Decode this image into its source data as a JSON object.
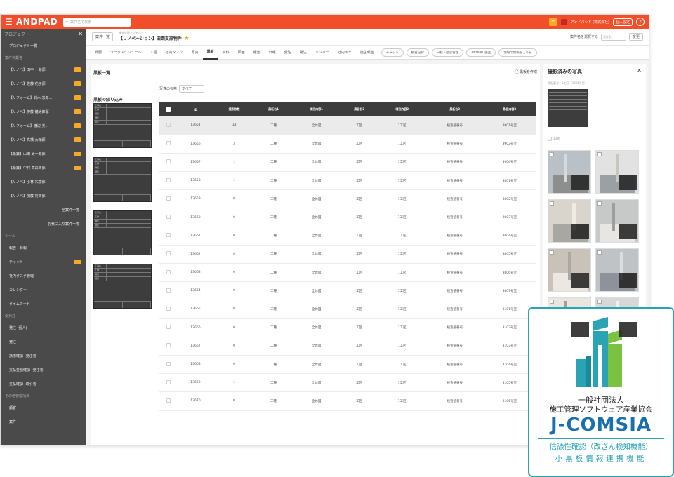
{
  "topbar": {
    "logo": "ANDPAD",
    "search_placeholder": "案件名で検索",
    "badge_count": "35",
    "company": "アンドパッド (株式会社)",
    "user_button": "個人設定",
    "help": "?"
  },
  "sidebar": {
    "header": "プロジェクト",
    "close": "✕",
    "items": [
      {
        "label": "プロジェクト一覧"
      },
      {
        "label": "案件作業者",
        "type": "section"
      },
      {
        "label": "【リノベ】田中 一郎邸",
        "badge": true
      },
      {
        "label": "【リノベ】佐藤 花子邸",
        "badge": true
      },
      {
        "label": "【リフォーム】鈴木 次郎...",
        "badge": true
      },
      {
        "label": "【リノベ】伊藤 健太郎邸",
        "badge": true
      },
      {
        "label": "【リフォーム】渡辺 美...",
        "badge": true
      },
      {
        "label": "【リノベ】高橋 大輔邸",
        "badge": true
      },
      {
        "label": "【新築】山田 太一郎邸",
        "badge": true
      },
      {
        "label": "【新築】中村 真由美邸",
        "badge": true
      },
      {
        "label": "【リノベ】小林 祐樹邸"
      },
      {
        "label": "【リノベ】加藤 裕美邸"
      },
      {
        "label": "全案件一覧",
        "type": "right"
      },
      {
        "label": "お気に入り案件一覧",
        "type": "right"
      },
      {
        "label": "ツール",
        "type": "section"
      },
      {
        "label": "報告・日報"
      },
      {
        "label": "チャット",
        "badge": true
      },
      {
        "label": "社内タスク管理"
      },
      {
        "label": "カレンダー"
      },
      {
        "label": "タイムカード"
      },
      {
        "label": "受発注",
        "type": "section"
      },
      {
        "label": "発注 (個人)"
      },
      {
        "label": "発注"
      },
      {
        "label": "請求確認 (発注者)"
      },
      {
        "label": "支払金額確認 (発注者)"
      },
      {
        "label": "支払確認 (取引者)"
      },
      {
        "label": "その他管理項目",
        "type": "section"
      },
      {
        "label": "顧客"
      },
      {
        "label": "案件"
      }
    ]
  },
  "header": {
    "back": "案件一覧",
    "company": "株式会社アンドパッド",
    "project": "【リノベーション】田園支部物件",
    "star": "★",
    "right_label": "案件名を選択する",
    "right_input": "案件名",
    "right_button": "変更"
  },
  "tabs": [
    {
      "label": "概要"
    },
    {
      "label": "ワークスケジュール"
    },
    {
      "label": "工程"
    },
    {
      "label": "社内タスク"
    },
    {
      "label": "写真"
    },
    {
      "label": "黒板",
      "active": true
    },
    {
      "label": "資料"
    },
    {
      "label": "図面"
    },
    {
      "label": "報告"
    },
    {
      "label": "日報"
    },
    {
      "label": "受注"
    },
    {
      "label": "発注"
    },
    {
      "label": "メンバー"
    },
    {
      "label": "社内メモ"
    },
    {
      "label": "施主報告"
    }
  ],
  "tab_buttons": [
    "チャット",
    "検査記録",
    "日程・勤怠管理",
    "ANDPAD施主",
    "現場の情報をこちら"
  ],
  "main": {
    "title": "黒板一覧",
    "link": "黒板を作成",
    "filter_label": "写真の有無",
    "filter_value": "すべて",
    "narrow_title": "黒板の絞り込み",
    "board_rows": [
      "工事名",
      "工種",
      "種別",
      "細別",
      "測点"
    ]
  },
  "table": {
    "headers": [
      "",
      "ID",
      "撮影枚数",
      "黒板名1",
      "項目内容1",
      "黒板名2",
      "項目内容2",
      "黒板名3",
      "黒板内容3"
    ],
    "rows": [
      [
        "13654",
        "13",
        "工種",
        "全体図",
        "工区",
        "1工区",
        "検査値番号",
        "3901号室"
      ],
      [
        "13656",
        "3",
        "工種",
        "全体図",
        "工区",
        "1工区",
        "検査値番号",
        "3902号室"
      ],
      [
        "13657",
        "1",
        "工種",
        "全体図",
        "工区",
        "1工区",
        "検査値番号",
        "3904号室"
      ],
      [
        "13658",
        "1",
        "工種",
        "全体図",
        "工区",
        "1工区",
        "検査値番号",
        "3801号室"
      ],
      [
        "13659",
        "0",
        "工種",
        "全体図",
        "工区",
        "1工区",
        "検査値番号",
        "3802号室"
      ],
      [
        "13660",
        "0",
        "工種",
        "全体図",
        "工区",
        "1工区",
        "検査値番号",
        "3803号室"
      ],
      [
        "13661",
        "0",
        "工種",
        "全体図",
        "工区",
        "1工区",
        "検査値番号",
        "3804号室"
      ],
      [
        "13662",
        "0",
        "工種",
        "全体図",
        "工区",
        "1工区",
        "検査値番号",
        "3805号室"
      ],
      [
        "13663",
        "0",
        "工種",
        "全体図",
        "工区",
        "1工区",
        "検査値番号",
        "3806号室"
      ],
      [
        "13664",
        "0",
        "工種",
        "全体図",
        "工区",
        "1工区",
        "検査値番号",
        "3807号室"
      ],
      [
        "13665",
        "0",
        "工種",
        "全体図",
        "工区",
        "1工区",
        "検査値番号",
        "3101号室"
      ],
      [
        "13666",
        "0",
        "工種",
        "全体図",
        "工区",
        "1工区",
        "検査値番号",
        "3102号室"
      ],
      [
        "13667",
        "0",
        "工種",
        "全体図",
        "工区",
        "1工区",
        "検査値番号",
        "3103号室"
      ],
      [
        "13668",
        "0",
        "工種",
        "全体図",
        "工区",
        "1工区",
        "検査値番号",
        "3104号室"
      ],
      [
        "13669",
        "1",
        "工種",
        "全体図",
        "工区",
        "1工区",
        "検査値番号",
        "3105号室"
      ],
      [
        "13670",
        "0",
        "工種",
        "全体図",
        "工区",
        "1工区",
        "検査値番号",
        "3106号室"
      ]
    ]
  },
  "panel": {
    "title": "撮影済みの写真",
    "close": "✕",
    "subtitle": "黒板番号：1工区・3901号室",
    "check_label": "13枚"
  },
  "cert": {
    "line1": "一般社団法人",
    "line2": "施工管理ソフトウェア産業協会",
    "logo": "J-COMSIA",
    "line3": "信憑性確認（改ざん検知機能）",
    "line4": "小黒板情報連携機能",
    "colors": {
      "teal": "#2aa3b5",
      "green": "#7cc242",
      "blue": "#1a6fae"
    }
  },
  "colors": {
    "brand": "#f04f2a",
    "sidebar": "#4a4a4a",
    "badge": "#f9a825"
  }
}
